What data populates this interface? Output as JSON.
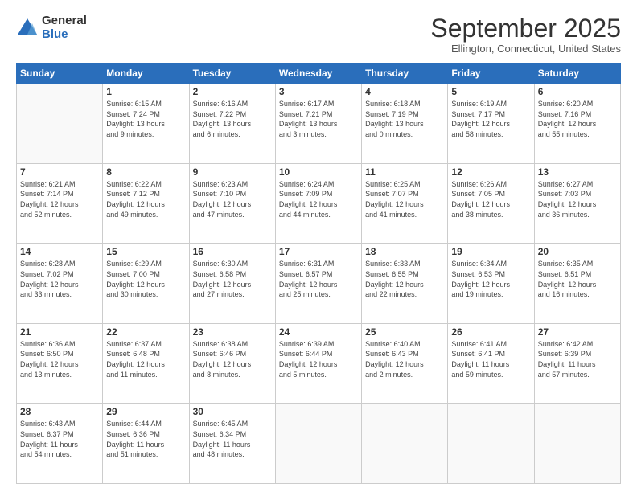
{
  "logo": {
    "general": "General",
    "blue": "Blue"
  },
  "header": {
    "month": "September 2025",
    "location": "Ellington, Connecticut, United States"
  },
  "weekdays": [
    "Sunday",
    "Monday",
    "Tuesday",
    "Wednesday",
    "Thursday",
    "Friday",
    "Saturday"
  ],
  "weeks": [
    [
      {
        "day": "",
        "info": ""
      },
      {
        "day": "1",
        "info": "Sunrise: 6:15 AM\nSunset: 7:24 PM\nDaylight: 13 hours\nand 9 minutes."
      },
      {
        "day": "2",
        "info": "Sunrise: 6:16 AM\nSunset: 7:22 PM\nDaylight: 13 hours\nand 6 minutes."
      },
      {
        "day": "3",
        "info": "Sunrise: 6:17 AM\nSunset: 7:21 PM\nDaylight: 13 hours\nand 3 minutes."
      },
      {
        "day": "4",
        "info": "Sunrise: 6:18 AM\nSunset: 7:19 PM\nDaylight: 13 hours\nand 0 minutes."
      },
      {
        "day": "5",
        "info": "Sunrise: 6:19 AM\nSunset: 7:17 PM\nDaylight: 12 hours\nand 58 minutes."
      },
      {
        "day": "6",
        "info": "Sunrise: 6:20 AM\nSunset: 7:16 PM\nDaylight: 12 hours\nand 55 minutes."
      }
    ],
    [
      {
        "day": "7",
        "info": "Sunrise: 6:21 AM\nSunset: 7:14 PM\nDaylight: 12 hours\nand 52 minutes."
      },
      {
        "day": "8",
        "info": "Sunrise: 6:22 AM\nSunset: 7:12 PM\nDaylight: 12 hours\nand 49 minutes."
      },
      {
        "day": "9",
        "info": "Sunrise: 6:23 AM\nSunset: 7:10 PM\nDaylight: 12 hours\nand 47 minutes."
      },
      {
        "day": "10",
        "info": "Sunrise: 6:24 AM\nSunset: 7:09 PM\nDaylight: 12 hours\nand 44 minutes."
      },
      {
        "day": "11",
        "info": "Sunrise: 6:25 AM\nSunset: 7:07 PM\nDaylight: 12 hours\nand 41 minutes."
      },
      {
        "day": "12",
        "info": "Sunrise: 6:26 AM\nSunset: 7:05 PM\nDaylight: 12 hours\nand 38 minutes."
      },
      {
        "day": "13",
        "info": "Sunrise: 6:27 AM\nSunset: 7:03 PM\nDaylight: 12 hours\nand 36 minutes."
      }
    ],
    [
      {
        "day": "14",
        "info": "Sunrise: 6:28 AM\nSunset: 7:02 PM\nDaylight: 12 hours\nand 33 minutes."
      },
      {
        "day": "15",
        "info": "Sunrise: 6:29 AM\nSunset: 7:00 PM\nDaylight: 12 hours\nand 30 minutes."
      },
      {
        "day": "16",
        "info": "Sunrise: 6:30 AM\nSunset: 6:58 PM\nDaylight: 12 hours\nand 27 minutes."
      },
      {
        "day": "17",
        "info": "Sunrise: 6:31 AM\nSunset: 6:57 PM\nDaylight: 12 hours\nand 25 minutes."
      },
      {
        "day": "18",
        "info": "Sunrise: 6:33 AM\nSunset: 6:55 PM\nDaylight: 12 hours\nand 22 minutes."
      },
      {
        "day": "19",
        "info": "Sunrise: 6:34 AM\nSunset: 6:53 PM\nDaylight: 12 hours\nand 19 minutes."
      },
      {
        "day": "20",
        "info": "Sunrise: 6:35 AM\nSunset: 6:51 PM\nDaylight: 12 hours\nand 16 minutes."
      }
    ],
    [
      {
        "day": "21",
        "info": "Sunrise: 6:36 AM\nSunset: 6:50 PM\nDaylight: 12 hours\nand 13 minutes."
      },
      {
        "day": "22",
        "info": "Sunrise: 6:37 AM\nSunset: 6:48 PM\nDaylight: 12 hours\nand 11 minutes."
      },
      {
        "day": "23",
        "info": "Sunrise: 6:38 AM\nSunset: 6:46 PM\nDaylight: 12 hours\nand 8 minutes."
      },
      {
        "day": "24",
        "info": "Sunrise: 6:39 AM\nSunset: 6:44 PM\nDaylight: 12 hours\nand 5 minutes."
      },
      {
        "day": "25",
        "info": "Sunrise: 6:40 AM\nSunset: 6:43 PM\nDaylight: 12 hours\nand 2 minutes."
      },
      {
        "day": "26",
        "info": "Sunrise: 6:41 AM\nSunset: 6:41 PM\nDaylight: 11 hours\nand 59 minutes."
      },
      {
        "day": "27",
        "info": "Sunrise: 6:42 AM\nSunset: 6:39 PM\nDaylight: 11 hours\nand 57 minutes."
      }
    ],
    [
      {
        "day": "28",
        "info": "Sunrise: 6:43 AM\nSunset: 6:37 PM\nDaylight: 11 hours\nand 54 minutes."
      },
      {
        "day": "29",
        "info": "Sunrise: 6:44 AM\nSunset: 6:36 PM\nDaylight: 11 hours\nand 51 minutes."
      },
      {
        "day": "30",
        "info": "Sunrise: 6:45 AM\nSunset: 6:34 PM\nDaylight: 11 hours\nand 48 minutes."
      },
      {
        "day": "",
        "info": ""
      },
      {
        "day": "",
        "info": ""
      },
      {
        "day": "",
        "info": ""
      },
      {
        "day": "",
        "info": ""
      }
    ]
  ]
}
